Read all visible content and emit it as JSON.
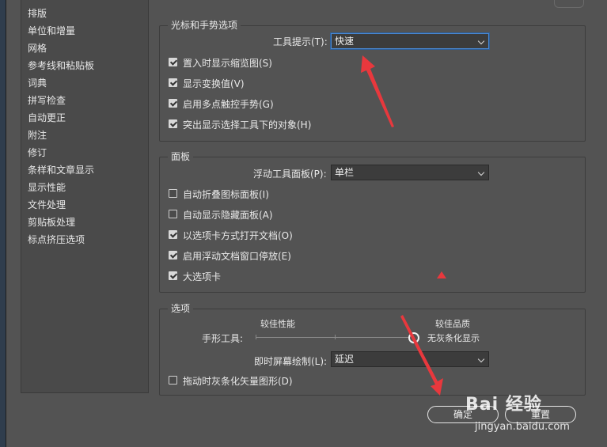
{
  "sidebar": {
    "items": [
      "排版",
      "单位和增量",
      "网格",
      "参考线和粘贴板",
      "词典",
      "拼写检查",
      "自动更正",
      "附注",
      "修订",
      "条样和文章显示",
      "显示性能",
      "文件处理",
      "剪贴板处理",
      "标点挤压选项"
    ]
  },
  "cursor_group": {
    "title": "光标和手势选项",
    "tooltip_label": "工具提示(T):",
    "tooltip_value": "快速",
    "checks": [
      {
        "label": "置入时显示缩览图(S)",
        "checked": true
      },
      {
        "label": "显示变换值(V)",
        "checked": true
      },
      {
        "label": "启用多点触控手势(G)",
        "checked": true
      },
      {
        "label": "突出显示选择工具下的对象(H)",
        "checked": true
      }
    ]
  },
  "panel_group": {
    "title": "面板",
    "floating_label": "浮动工具面板(P):",
    "floating_value": "单栏",
    "checks": [
      {
        "label": "自动折叠图标面板(I)",
        "checked": false
      },
      {
        "label": "自动显示隐藏面板(A)",
        "checked": false
      },
      {
        "label": "以选项卡方式打开文档(O)",
        "checked": true
      },
      {
        "label": "启用浮动文档窗口停放(E)",
        "checked": true
      },
      {
        "label": "大选项卡",
        "checked": true
      }
    ]
  },
  "options_group": {
    "title": "选项",
    "slider_left": "较佳性能",
    "slider_right": "较佳品质",
    "slider_sub": "无灰条化显示",
    "hand_tool_label": "手形工具:",
    "hand_tool_level": 1.0,
    "live_label": "即时屏幕绘制(L):",
    "live_value": "延迟",
    "gray_check": {
      "label": "拖动时灰条化矢量图形(D)",
      "checked": false
    }
  },
  "buttons": {
    "ok": "确定",
    "reset": "重置"
  },
  "watermark": {
    "brand": "Bai 经验",
    "url": "jingyan.baidu.com"
  },
  "colors": {
    "arrow": "#e8383d",
    "focus": "#4a8ad6"
  }
}
